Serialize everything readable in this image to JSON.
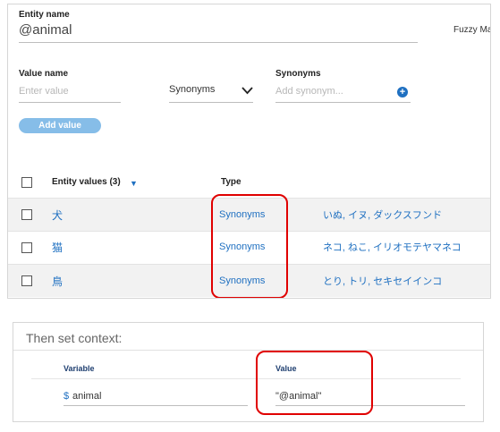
{
  "entity": {
    "name_label": "Entity name",
    "name_value": "@animal",
    "fuzzy_label": "Fuzzy Ma"
  },
  "new_value": {
    "value_label": "Value name",
    "value_placeholder": "Enter value",
    "type_select": "Synonyms",
    "synonyms_label": "Synonyms",
    "synonyms_placeholder": "Add synonym...",
    "add_button": "Add value"
  },
  "table": {
    "header_values": "Entity values (3)",
    "header_type": "Type",
    "rows": [
      {
        "value": "犬",
        "type": "Synonyms",
        "synonyms": "いぬ, イヌ, ダックスフンド"
      },
      {
        "value": "猫",
        "type": "Synonyms",
        "synonyms": "ネコ, ねこ, イリオモテヤマネコ"
      },
      {
        "value": "鳥",
        "type": "Synonyms",
        "synonyms": "とり, トリ, セキセイインコ"
      }
    ]
  },
  "context": {
    "title": "Then set context:",
    "variable_header": "Variable",
    "value_header": "Value",
    "dollar": "$",
    "variable": "animal",
    "value": "\"@animal\""
  },
  "colors": {
    "link": "#1f70c1",
    "highlight": "#e00000",
    "button": "#86bde8"
  }
}
